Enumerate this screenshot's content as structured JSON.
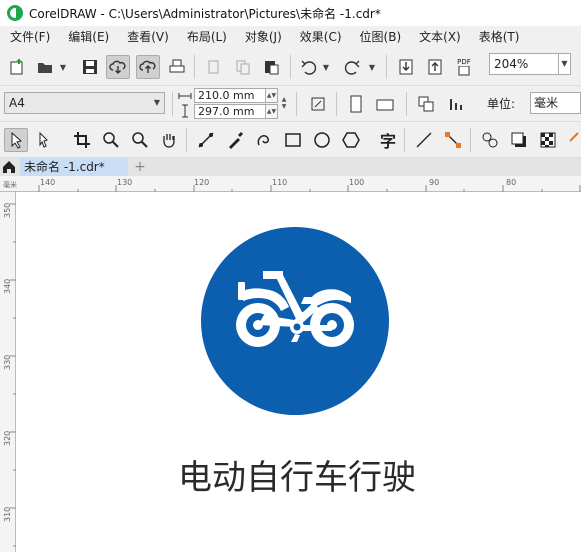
{
  "window": {
    "title": "CorelDRAW - C:\\Users\\Administrator\\Pictures\\未命名 -1.cdr*"
  },
  "menu": [
    "文件(F)",
    "编辑(E)",
    "查看(V)",
    "布局(L)",
    "对象(J)",
    "效果(C)",
    "位图(B)",
    "文本(X)",
    "表格(T)"
  ],
  "toolbar": {
    "zoom": "204%",
    "pdf_label": "PDF"
  },
  "properties": {
    "page_size": "A4",
    "width": "210.0 mm",
    "height": "297.0 mm",
    "unit_label": "单位:",
    "unit_value": "毫米"
  },
  "toolbox": {
    "text_tool_glyph": "字"
  },
  "tabs": {
    "doc_tab": "未命名 -1.cdr*",
    "add": "+"
  },
  "ruler_h": {
    "unit": "毫米",
    "ticks": [
      "140",
      "130",
      "120",
      "110",
      "100",
      "90",
      "80"
    ]
  },
  "ruler_v": {
    "ticks": [
      "350",
      "340",
      "330",
      "320",
      "310"
    ]
  },
  "artwork": {
    "caption": "电动自行车行驶",
    "sign_color": "#0c5eae"
  }
}
